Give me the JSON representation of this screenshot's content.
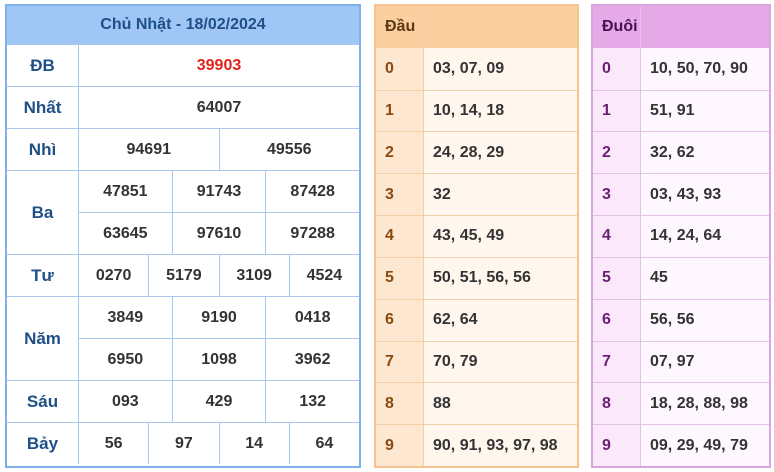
{
  "results": {
    "title": "Chủ Nhật - 18/02/2024",
    "prizes": [
      {
        "label": "ĐB",
        "rows": [
          [
            "39903"
          ]
        ],
        "special": true
      },
      {
        "label": "Nhất",
        "rows": [
          [
            "64007"
          ]
        ]
      },
      {
        "label": "Nhì",
        "rows": [
          [
            "94691",
            "49556"
          ]
        ]
      },
      {
        "label": "Ba",
        "rows": [
          [
            "47851",
            "91743",
            "87428"
          ],
          [
            "63645",
            "97610",
            "97288"
          ]
        ]
      },
      {
        "label": "Tư",
        "rows": [
          [
            "0270",
            "5179",
            "3109",
            "4524"
          ]
        ]
      },
      {
        "label": "Năm",
        "rows": [
          [
            "3849",
            "9190",
            "0418"
          ],
          [
            "6950",
            "1098",
            "3962"
          ]
        ]
      },
      {
        "label": "Sáu",
        "rows": [
          [
            "093",
            "429",
            "132"
          ]
        ]
      },
      {
        "label": "Bảy",
        "rows": [
          [
            "56",
            "97",
            "14",
            "64"
          ]
        ]
      }
    ]
  },
  "head_table": {
    "header": "Đầu",
    "rows": [
      {
        "key": "0",
        "values": "03, 07, 09"
      },
      {
        "key": "1",
        "values": "10, 14, 18"
      },
      {
        "key": "2",
        "values": "24, 28, 29"
      },
      {
        "key": "3",
        "values": "32"
      },
      {
        "key": "4",
        "values": "43, 45, 49"
      },
      {
        "key": "5",
        "values": "50, 51, 56, 56"
      },
      {
        "key": "6",
        "values": "62, 64"
      },
      {
        "key": "7",
        "values": "70, 79"
      },
      {
        "key": "8",
        "values": "88"
      },
      {
        "key": "9",
        "values": "90, 91, 93, 97, 98"
      }
    ]
  },
  "tail_table": {
    "header": "Đuôi",
    "rows": [
      {
        "key": "0",
        "values": "10, 50, 70, 90"
      },
      {
        "key": "1",
        "values": "51, 91"
      },
      {
        "key": "2",
        "values": "32, 62"
      },
      {
        "key": "3",
        "values": "03, 43, 93"
      },
      {
        "key": "4",
        "values": "14, 24, 64"
      },
      {
        "key": "5",
        "values": "45"
      },
      {
        "key": "6",
        "values": "56, 56"
      },
      {
        "key": "7",
        "values": "07, 97"
      },
      {
        "key": "8",
        "values": "18, 28, 88, 98"
      },
      {
        "key": "9",
        "values": "09, 29, 49, 79"
      }
    ]
  },
  "colors": {
    "special_prize": "#e2231a",
    "results_header": "#9fc6f5",
    "head_header": "#fbcf9f",
    "tail_header": "#e6a9e8"
  }
}
